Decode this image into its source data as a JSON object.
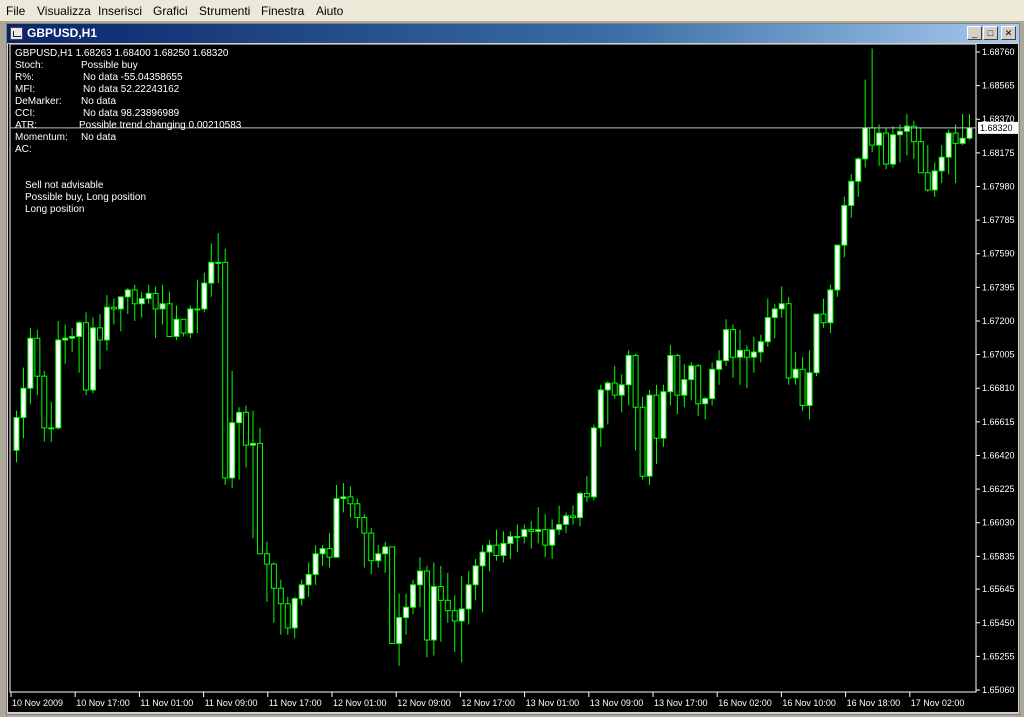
{
  "menu": [
    "File",
    "Visualizza",
    "Inserisci",
    "Grafici",
    "Strumenti",
    "Finestra",
    "Aiuto"
  ],
  "window": {
    "title": "GBPUSD,H1",
    "btn_min": "_",
    "btn_max": "□",
    "btn_close": "✕"
  },
  "info": {
    "header": "GBPUSD,H1  1.68263 1.68400 1.68250 1.68320",
    "rows": [
      {
        "key": "Stoch:",
        "value": "Possible buy"
      },
      {
        "key": "R%:",
        "value": "No data -55.04358655"
      },
      {
        "key": "MFI:",
        "value": "No data 52.22243162"
      },
      {
        "key": "DeMarker:",
        "value": "No data"
      },
      {
        "key": "CCI:",
        "value": "No data 98.23896989"
      },
      {
        "key": "ATR:",
        "value": "Possible trend changing 0.00210583"
      },
      {
        "key": "Momentum:",
        "value": "No data"
      },
      {
        "key": "AC:",
        "value": ""
      }
    ],
    "messages": [
      "Sell not advisable",
      "Possible buy, Long position",
      "Long position"
    ]
  },
  "colors": {
    "background": "#000000",
    "bull_fill": "#ffffff",
    "bear_fill": "#000000",
    "wick": "#00ff00",
    "text": "#ffffff",
    "price_line": "#c0c0c0"
  },
  "chart_data": {
    "type": "candlestick",
    "symbol": "GBPUSD",
    "timeframe": "H1",
    "current_price": "1.68320",
    "y_ticks": [
      "1.68760",
      "1.68565",
      "1.68370",
      "1.68175",
      "1.67980",
      "1.67785",
      "1.67590",
      "1.67395",
      "1.67200",
      "1.67005",
      "1.66810",
      "1.66615",
      "1.66420",
      "1.66225",
      "1.66030",
      "1.65835",
      "1.65645",
      "1.65450",
      "1.65255",
      "1.65060"
    ],
    "ylim": [
      1.6506,
      1.6876
    ],
    "x_ticks": [
      "10 Nov 2009",
      "10 Nov 17:00",
      "11 Nov 01:00",
      "11 Nov 09:00",
      "11 Nov 17:00",
      "12 Nov 01:00",
      "12 Nov 09:00",
      "12 Nov 17:00",
      "13 Nov 01:00",
      "13 Nov 09:00",
      "13 Nov 17:00",
      "16 Nov 02:00",
      "16 Nov 10:00",
      "16 Nov 18:00",
      "17 Nov 02:00"
    ],
    "candles": [
      [
        1.6645,
        1.6668,
        1.6638,
        1.6664
      ],
      [
        1.6664,
        1.6693,
        1.6652,
        1.6681
      ],
      [
        1.6681,
        1.6716,
        1.6672,
        1.671
      ],
      [
        1.671,
        1.6715,
        1.6677,
        1.6688
      ],
      [
        1.6688,
        1.6691,
        1.665,
        1.6658
      ],
      [
        1.6658,
        1.6673,
        1.665,
        1.6658
      ],
      [
        1.6658,
        1.672,
        1.6657,
        1.6709
      ],
      [
        1.6709,
        1.6718,
        1.6695,
        1.671
      ],
      [
        1.671,
        1.6716,
        1.6702,
        1.6711
      ],
      [
        1.6711,
        1.672,
        1.669,
        1.6719
      ],
      [
        1.6719,
        1.6725,
        1.6677,
        1.668
      ],
      [
        1.668,
        1.6722,
        1.6678,
        1.6716
      ],
      [
        1.6716,
        1.6724,
        1.6692,
        1.6709
      ],
      [
        1.6709,
        1.6735,
        1.6703,
        1.6728
      ],
      [
        1.6728,
        1.6733,
        1.6718,
        1.6727
      ],
      [
        1.6727,
        1.6734,
        1.6714,
        1.6734
      ],
      [
        1.6734,
        1.6739,
        1.6724,
        1.6738
      ],
      [
        1.6738,
        1.6741,
        1.672,
        1.673
      ],
      [
        1.673,
        1.6737,
        1.6722,
        1.6733
      ],
      [
        1.6733,
        1.6741,
        1.673,
        1.6736
      ],
      [
        1.6736,
        1.674,
        1.671,
        1.6727
      ],
      [
        1.6727,
        1.6741,
        1.6718,
        1.673
      ],
      [
        1.673,
        1.6737,
        1.6715,
        1.6711
      ],
      [
        1.6711,
        1.6729,
        1.6709,
        1.6721
      ],
      [
        1.6721,
        1.6721,
        1.6711,
        1.6713
      ],
      [
        1.6713,
        1.6729,
        1.671,
        1.6727
      ],
      [
        1.6727,
        1.6744,
        1.6713,
        1.6727
      ],
      [
        1.6727,
        1.6748,
        1.6725,
        1.6742
      ],
      [
        1.6742,
        1.6765,
        1.6734,
        1.6754
      ],
      [
        1.6754,
        1.6771,
        1.6742,
        1.6754
      ],
      [
        1.6754,
        1.6762,
        1.6625,
        1.6629
      ],
      [
        1.6629,
        1.6691,
        1.6623,
        1.6661
      ],
      [
        1.6661,
        1.667,
        1.6628,
        1.6667
      ],
      [
        1.6667,
        1.6671,
        1.6635,
        1.6648
      ],
      [
        1.6648,
        1.6668,
        1.6594,
        1.6649
      ],
      [
        1.6649,
        1.6658,
        1.6587,
        1.6585
      ],
      [
        1.6585,
        1.6592,
        1.6557,
        1.6579
      ],
      [
        1.6579,
        1.658,
        1.6545,
        1.6565
      ],
      [
        1.6565,
        1.657,
        1.6538,
        1.6556
      ],
      [
        1.6556,
        1.656,
        1.6538,
        1.6542
      ],
      [
        1.6542,
        1.656,
        1.6536,
        1.6559
      ],
      [
        1.6559,
        1.657,
        1.6555,
        1.6567
      ],
      [
        1.6567,
        1.658,
        1.656,
        1.6573
      ],
      [
        1.6573,
        1.659,
        1.6567,
        1.6585
      ],
      [
        1.6585,
        1.659,
        1.6578,
        1.6588
      ],
      [
        1.6588,
        1.6597,
        1.6577,
        1.6583
      ],
      [
        1.6583,
        1.6625,
        1.6583,
        1.6617
      ],
      [
        1.6617,
        1.6626,
        1.6609,
        1.6618
      ],
      [
        1.6618,
        1.6624,
        1.6606,
        1.6614
      ],
      [
        1.6614,
        1.6617,
        1.66,
        1.6606
      ],
      [
        1.6606,
        1.6608,
        1.6577,
        1.6597
      ],
      [
        1.6597,
        1.66,
        1.6573,
        1.6581
      ],
      [
        1.6581,
        1.659,
        1.6577,
        1.6585
      ],
      [
        1.6585,
        1.6592,
        1.6574,
        1.6589
      ],
      [
        1.6589,
        1.6588,
        1.6535,
        1.6533
      ],
      [
        1.6533,
        1.6562,
        1.652,
        1.6548
      ],
      [
        1.6548,
        1.6562,
        1.6538,
        1.6554
      ],
      [
        1.6554,
        1.657,
        1.655,
        1.6567
      ],
      [
        1.6567,
        1.6583,
        1.6554,
        1.6575
      ],
      [
        1.6575,
        1.6578,
        1.6525,
        1.6535
      ],
      [
        1.6535,
        1.658,
        1.6526,
        1.6566
      ],
      [
        1.6566,
        1.6578,
        1.6534,
        1.6558
      ],
      [
        1.6558,
        1.6574,
        1.6545,
        1.6552
      ],
      [
        1.6552,
        1.6561,
        1.6528,
        1.6546
      ],
      [
        1.6546,
        1.6572,
        1.6522,
        1.6553
      ],
      [
        1.6553,
        1.6575,
        1.6544,
        1.6567
      ],
      [
        1.6567,
        1.6582,
        1.6558,
        1.6578
      ],
      [
        1.6578,
        1.659,
        1.6551,
        1.6586
      ],
      [
        1.6586,
        1.6593,
        1.6575,
        1.659
      ],
      [
        1.659,
        1.6599,
        1.6581,
        1.6584
      ],
      [
        1.6584,
        1.6598,
        1.658,
        1.6591
      ],
      [
        1.6591,
        1.6598,
        1.6582,
        1.6595
      ],
      [
        1.6595,
        1.6602,
        1.6586,
        1.6595
      ],
      [
        1.6595,
        1.6602,
        1.6591,
        1.6599
      ],
      [
        1.6599,
        1.6604,
        1.6588,
        1.6598
      ],
      [
        1.6598,
        1.6612,
        1.6591,
        1.6599
      ],
      [
        1.6599,
        1.6608,
        1.6583,
        1.659
      ],
      [
        1.659,
        1.6605,
        1.6582,
        1.6599
      ],
      [
        1.6599,
        1.6613,
        1.6596,
        1.6602
      ],
      [
        1.6602,
        1.6609,
        1.6597,
        1.6607
      ],
      [
        1.6607,
        1.6613,
        1.6602,
        1.6606
      ],
      [
        1.6606,
        1.6621,
        1.6601,
        1.662
      ],
      [
        1.662,
        1.663,
        1.6615,
        1.6618
      ],
      [
        1.6618,
        1.666,
        1.6616,
        1.6658
      ],
      [
        1.6658,
        1.6683,
        1.6647,
        1.668
      ],
      [
        1.668,
        1.6685,
        1.666,
        1.6684
      ],
      [
        1.6684,
        1.6694,
        1.6675,
        1.6677
      ],
      [
        1.6677,
        1.6689,
        1.6667,
        1.6683
      ],
      [
        1.6683,
        1.6703,
        1.6671,
        1.67
      ],
      [
        1.67,
        1.6701,
        1.6645,
        1.667
      ],
      [
        1.667,
        1.6676,
        1.6628,
        1.663
      ],
      [
        1.663,
        1.668,
        1.6625,
        1.6677
      ],
      [
        1.6677,
        1.6683,
        1.6637,
        1.6652
      ],
      [
        1.6652,
        1.6683,
        1.6647,
        1.6679
      ],
      [
        1.6679,
        1.6706,
        1.6671,
        1.67
      ],
      [
        1.67,
        1.6701,
        1.6666,
        1.6677
      ],
      [
        1.6677,
        1.6695,
        1.667,
        1.6686
      ],
      [
        1.6686,
        1.6696,
        1.6674,
        1.6694
      ],
      [
        1.6694,
        1.6695,
        1.6665,
        1.6672
      ],
      [
        1.6672,
        1.6676,
        1.6663,
        1.6675
      ],
      [
        1.6675,
        1.6696,
        1.6671,
        1.6692
      ],
      [
        1.6692,
        1.6703,
        1.6683,
        1.6697
      ],
      [
        1.6697,
        1.6721,
        1.6694,
        1.6715
      ],
      [
        1.6715,
        1.6718,
        1.6687,
        1.6699
      ],
      [
        1.6699,
        1.6715,
        1.6683,
        1.6703
      ],
      [
        1.6703,
        1.6706,
        1.6681,
        1.6699
      ],
      [
        1.6699,
        1.6711,
        1.669,
        1.6702
      ],
      [
        1.6702,
        1.6712,
        1.6696,
        1.6708
      ],
      [
        1.6708,
        1.6733,
        1.6705,
        1.6722
      ],
      [
        1.6722,
        1.673,
        1.671,
        1.6727
      ],
      [
        1.6727,
        1.674,
        1.6722,
        1.673
      ],
      [
        1.673,
        1.6734,
        1.6683,
        1.6687
      ],
      [
        1.6687,
        1.6702,
        1.6683,
        1.6692
      ],
      [
        1.6692,
        1.6699,
        1.6668,
        1.6671
      ],
      [
        1.6671,
        1.6703,
        1.6663,
        1.669
      ],
      [
        1.669,
        1.6718,
        1.6688,
        1.6724
      ],
      [
        1.6724,
        1.6733,
        1.6716,
        1.6719
      ],
      [
        1.6719,
        1.6741,
        1.6713,
        1.6738
      ],
      [
        1.6738,
        1.676,
        1.6734,
        1.6764
      ],
      [
        1.6764,
        1.6792,
        1.6757,
        1.6787
      ],
      [
        1.6787,
        1.6805,
        1.678,
        1.6801
      ],
      [
        1.6801,
        1.6815,
        1.6792,
        1.6814
      ],
      [
        1.6814,
        1.686,
        1.6809,
        1.6832
      ],
      [
        1.6832,
        1.6878,
        1.6818,
        1.6822
      ],
      [
        1.6822,
        1.6834,
        1.681,
        1.6829
      ],
      [
        1.6829,
        1.6832,
        1.6808,
        1.6811
      ],
      [
        1.6811,
        1.6833,
        1.6809,
        1.6828
      ],
      [
        1.6828,
        1.6834,
        1.6812,
        1.683
      ],
      [
        1.683,
        1.684,
        1.6816,
        1.6833
      ],
      [
        1.6833,
        1.6836,
        1.6814,
        1.6824
      ],
      [
        1.6824,
        1.6832,
        1.681,
        1.6806
      ],
      [
        1.6806,
        1.6822,
        1.6795,
        1.6796
      ],
      [
        1.6796,
        1.6812,
        1.6792,
        1.6807
      ],
      [
        1.6807,
        1.6822,
        1.68,
        1.6815
      ],
      [
        1.6815,
        1.6831,
        1.6805,
        1.6829
      ],
      [
        1.6829,
        1.6834,
        1.68,
        1.6823
      ],
      [
        1.6823,
        1.684,
        1.6822,
        1.6826
      ],
      [
        1.6826,
        1.684,
        1.6825,
        1.6832
      ]
    ]
  }
}
